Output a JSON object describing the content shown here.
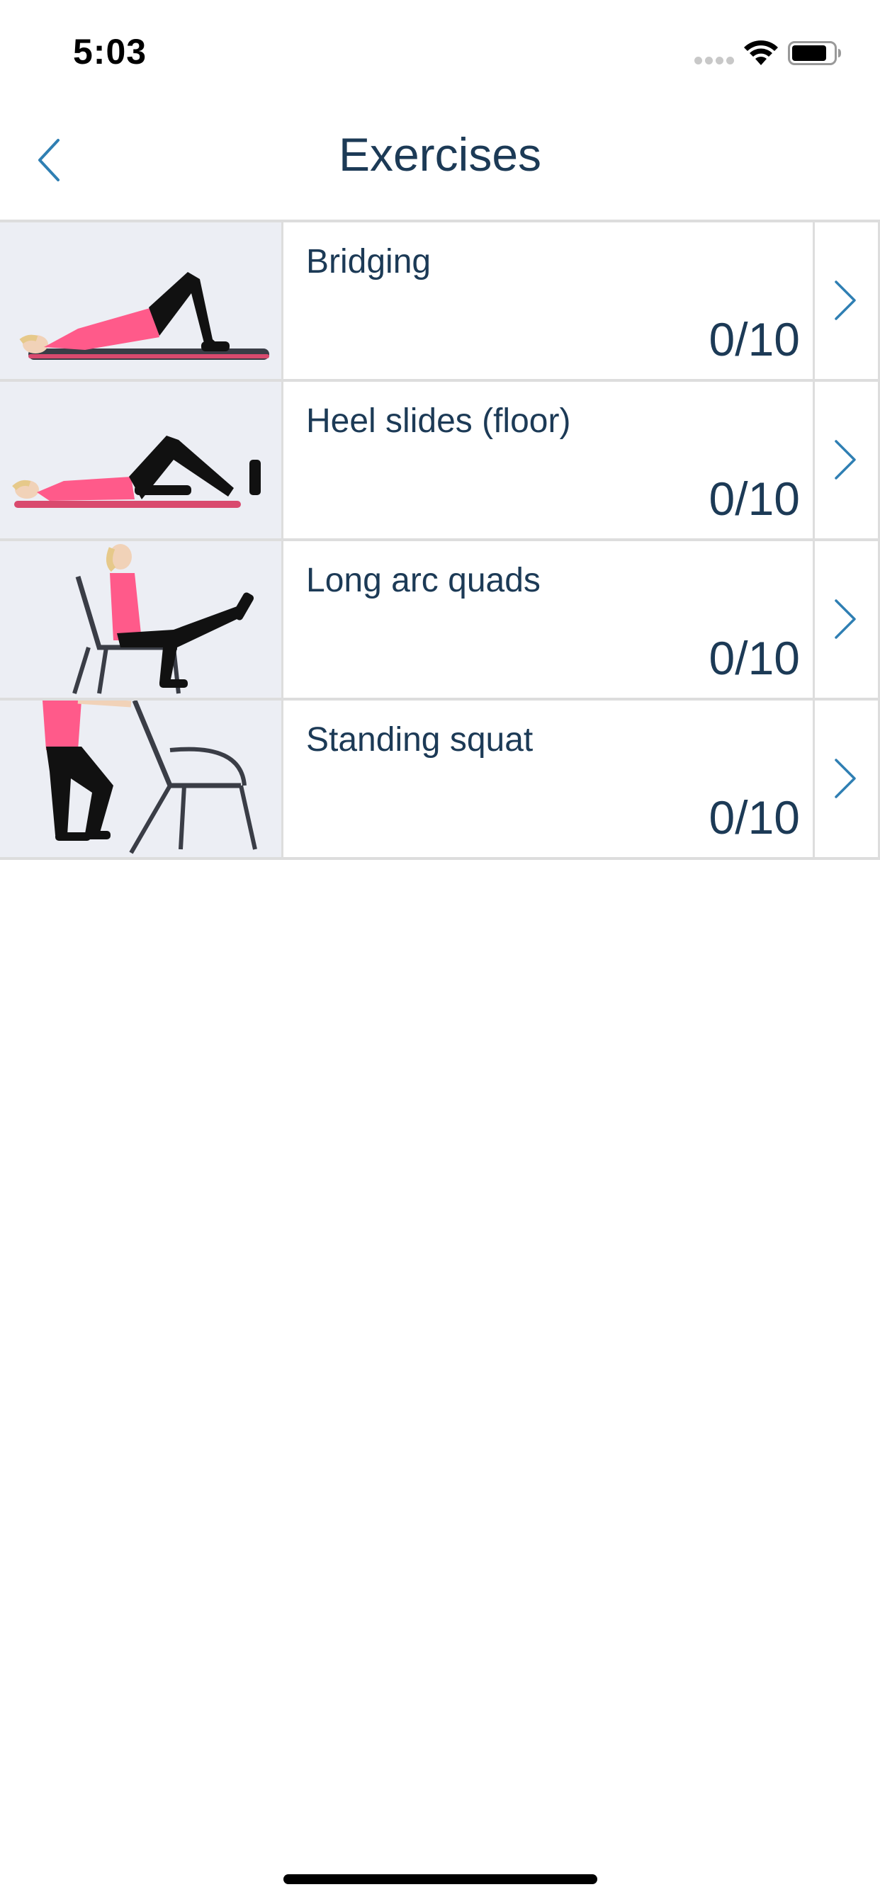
{
  "status_bar": {
    "time": "5:03",
    "icons": [
      "signal-icon",
      "wifi-icon",
      "battery-icon"
    ]
  },
  "nav": {
    "title": "Exercises",
    "back_icon": "chevron-left-icon"
  },
  "exercises": [
    {
      "name": "Bridging",
      "progress": "0/10",
      "thumbnail": "bridging-image"
    },
    {
      "name": "Heel slides (floor)",
      "progress": "0/10",
      "thumbnail": "heel-slides-image"
    },
    {
      "name": "Long arc quads",
      "progress": "0/10",
      "thumbnail": "long-arc-quads-image"
    },
    {
      "name": "Standing squat",
      "progress": "0/10",
      "thumbnail": "standing-squat-image"
    }
  ],
  "colors": {
    "text": "#1c3a56",
    "accent": "#2f7fb3",
    "divider": "#dddddd",
    "shirt": "#ff5a8a",
    "pants": "#111111",
    "mat": "#3a3d46"
  }
}
